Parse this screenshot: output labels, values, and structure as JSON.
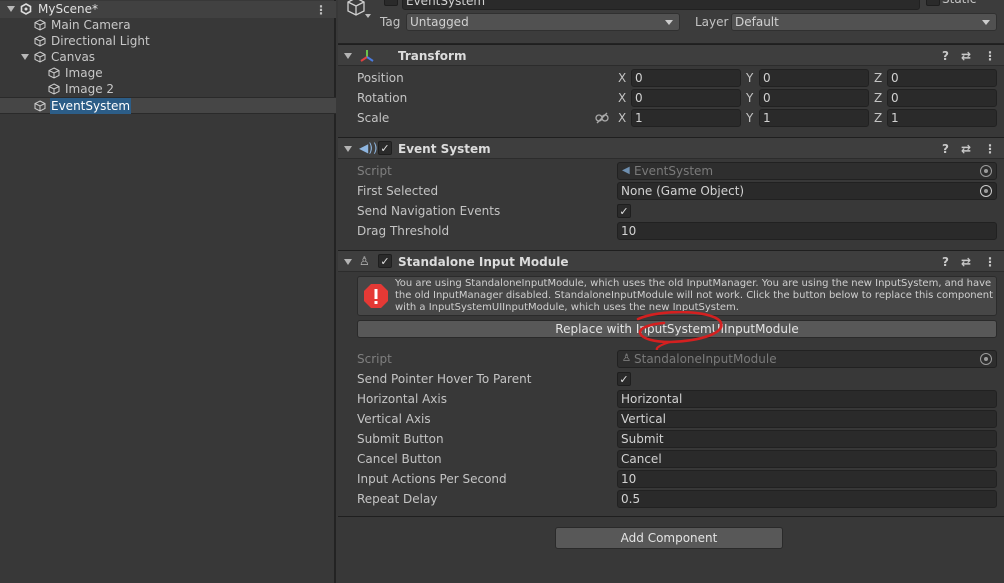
{
  "hierarchy": {
    "scene": "MyScene*",
    "items": [
      "Main Camera",
      "Directional Light",
      "Canvas",
      "Image",
      "Image 2",
      "EventSystem"
    ]
  },
  "header": {
    "name": "EventSystem",
    "static_label": "Static",
    "tag_label": "Tag",
    "tag_value": "Untagged",
    "layer_label": "Layer",
    "layer_value": "Default"
  },
  "transform": {
    "title": "Transform",
    "rows": [
      {
        "label": "Position",
        "x": "0",
        "y": "0",
        "z": "0"
      },
      {
        "label": "Rotation",
        "x": "0",
        "y": "0",
        "z": "0"
      },
      {
        "label": "Scale",
        "x": "1",
        "y": "1",
        "z": "1"
      }
    ],
    "axis": {
      "x": "X",
      "y": "Y",
      "z": "Z"
    }
  },
  "event_system": {
    "title": "Event System",
    "script_label": "Script",
    "script_value": "EventSystem",
    "first_selected_label": "First Selected",
    "first_selected_value": "None (Game Object)",
    "send_nav_label": "Send Navigation Events",
    "drag_label": "Drag Threshold",
    "drag_value": "10"
  },
  "standalone": {
    "title": "Standalone Input Module",
    "warning": "You are using StandaloneInputModule, which uses the old InputManager. You are using the new InputSystem, and have the old InputManager disabled. StandaloneInputModule will not work. Click the button below to replace this component with a InputSystemUIInputModule, which uses the new InputSystem.",
    "replace_button": "Replace with InputSystemUIInputModule",
    "script_label": "Script",
    "script_value": "StandaloneInputModule",
    "rows": [
      {
        "label": "Send Pointer Hover To Parent",
        "value": ""
      },
      {
        "label": "Horizontal Axis",
        "value": "Horizontal"
      },
      {
        "label": "Vertical Axis",
        "value": "Vertical"
      },
      {
        "label": "Submit Button",
        "value": "Submit"
      },
      {
        "label": "Cancel Button",
        "value": "Cancel"
      },
      {
        "label": "Input Actions Per Second",
        "value": "10"
      },
      {
        "label": "Repeat Delay",
        "value": "0.5"
      }
    ]
  },
  "add_component": "Add Component",
  "colors": {
    "selection": "#2c5d87",
    "error": "#e53935",
    "annotation": "#d42020"
  }
}
